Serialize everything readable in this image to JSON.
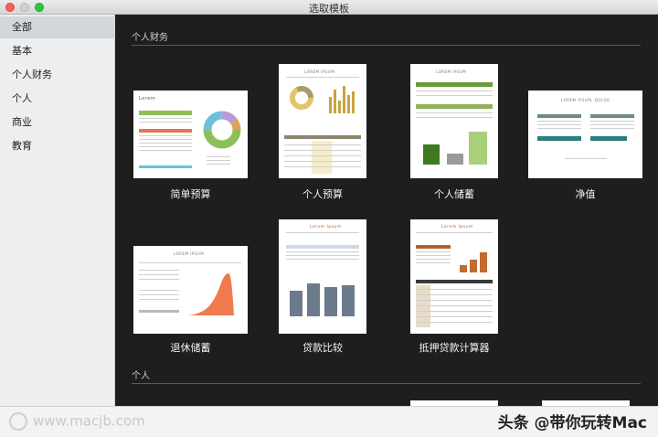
{
  "window": {
    "title": "选取模板"
  },
  "sidebar": {
    "items": [
      {
        "label": "全部",
        "selected": true
      },
      {
        "label": "基本"
      },
      {
        "label": "个人财务"
      },
      {
        "label": "个人"
      },
      {
        "label": "商业"
      },
      {
        "label": "教育"
      }
    ]
  },
  "sections": [
    {
      "title": "个人财务"
    },
    {
      "title": "个人"
    }
  ],
  "templates": [
    {
      "label": "简单预算",
      "thumb_title": "Lorem"
    },
    {
      "label": "个人预算",
      "thumb_title": "LOREM IPSUM"
    },
    {
      "label": "个人储蓄",
      "thumb_title": "LOREM IPSUM"
    },
    {
      "label": "净值",
      "thumb_title": "LOREM IPSUM, DOLOR"
    },
    {
      "label": "退休储蓄",
      "thumb_title": "LOREM IPSUM"
    },
    {
      "label": "贷款比较",
      "thumb_title": "Lorem Ipsum"
    },
    {
      "label": "抵押贷款计算器",
      "thumb_title": "Lorem Ipsum"
    }
  ],
  "colors": {
    "accent_green": "#6a9a3a",
    "accent_orange": "#e8643a",
    "accent_slate": "#6c7b8b",
    "accent_brown": "#b5602a"
  },
  "watermark": {
    "left": "www.macjb.com",
    "right": "头条 @带你玩转Mac"
  }
}
